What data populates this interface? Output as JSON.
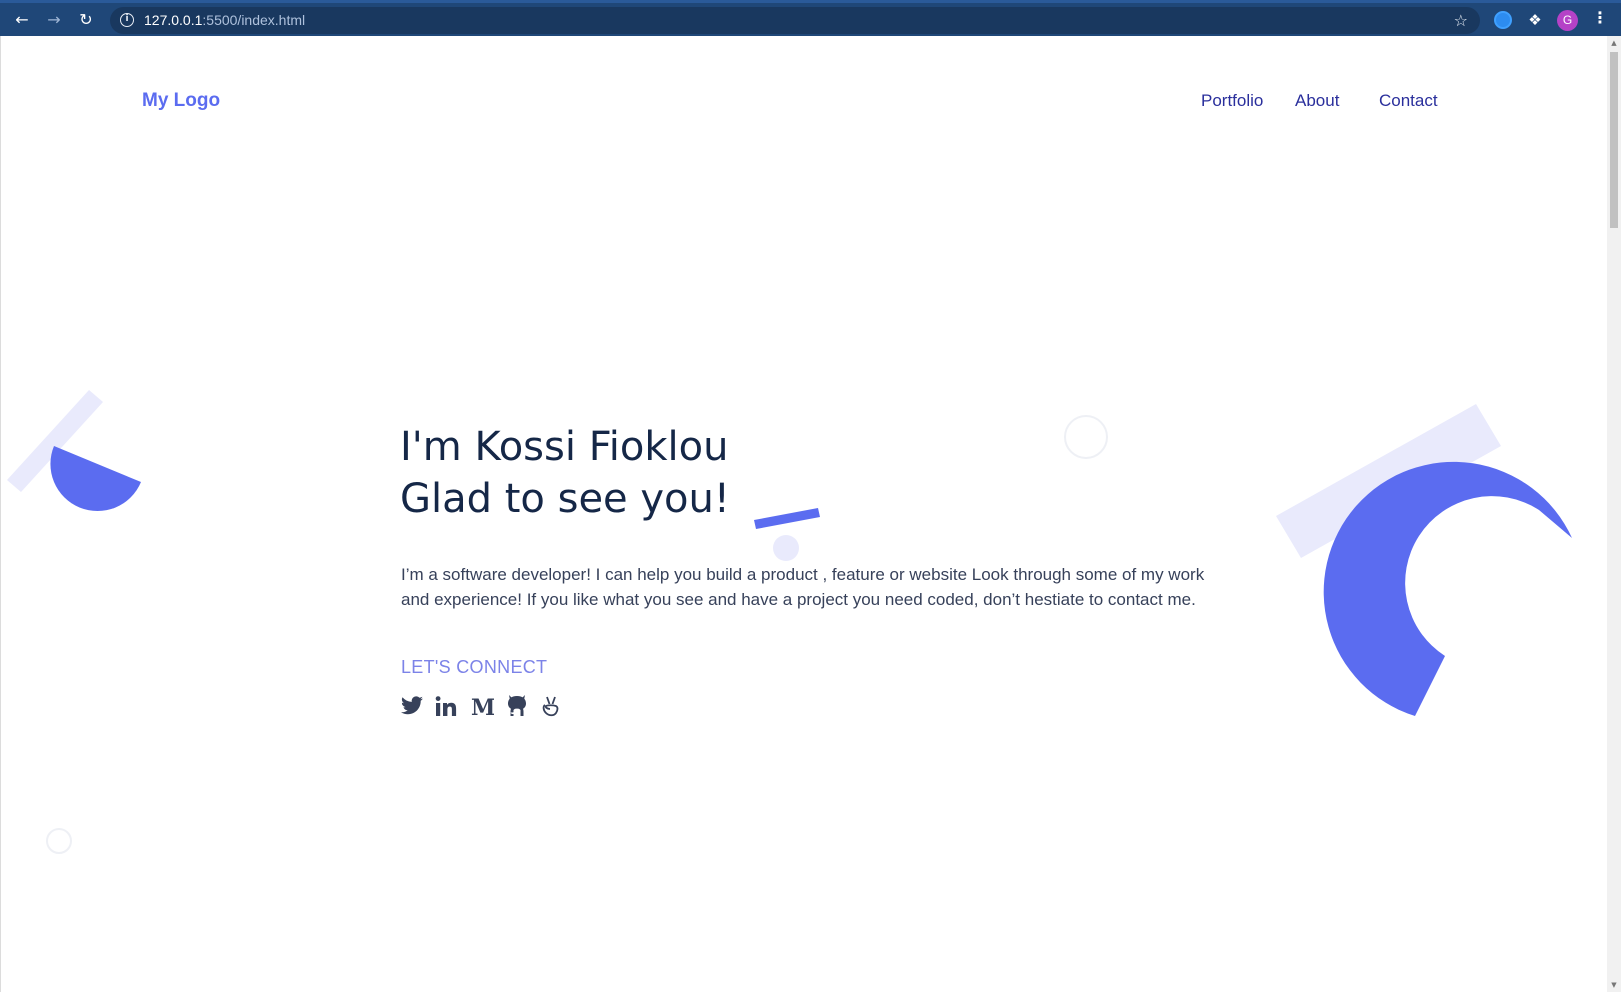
{
  "browser": {
    "url_host": "127.0.0.1",
    "url_rest": ":5500/index.html",
    "profile_initial": "G"
  },
  "header": {
    "logo": "My Logo",
    "nav": [
      "Portfolio",
      "About",
      "Contact"
    ]
  },
  "hero": {
    "title_line1": "I'm Kossi Fioklou",
    "title_line2": "Glad to see you!",
    "description": "I’m a software developer! I can help you build a product , feature or website Look through some of my work and experience! If you like what you see and have a project you need coded, don’t hestiate to contact me.",
    "connect_label": "LET'S CONNECT",
    "socials": [
      "twitter-icon",
      "linkedin-icon",
      "medium-icon",
      "github-icon",
      "angellist-icon"
    ]
  },
  "colors": {
    "accent": "#5b6cf0",
    "accent_light": "#e9eafc",
    "heading": "#152747",
    "nav": "#2a2f9c",
    "chrome": "#1f4778"
  }
}
